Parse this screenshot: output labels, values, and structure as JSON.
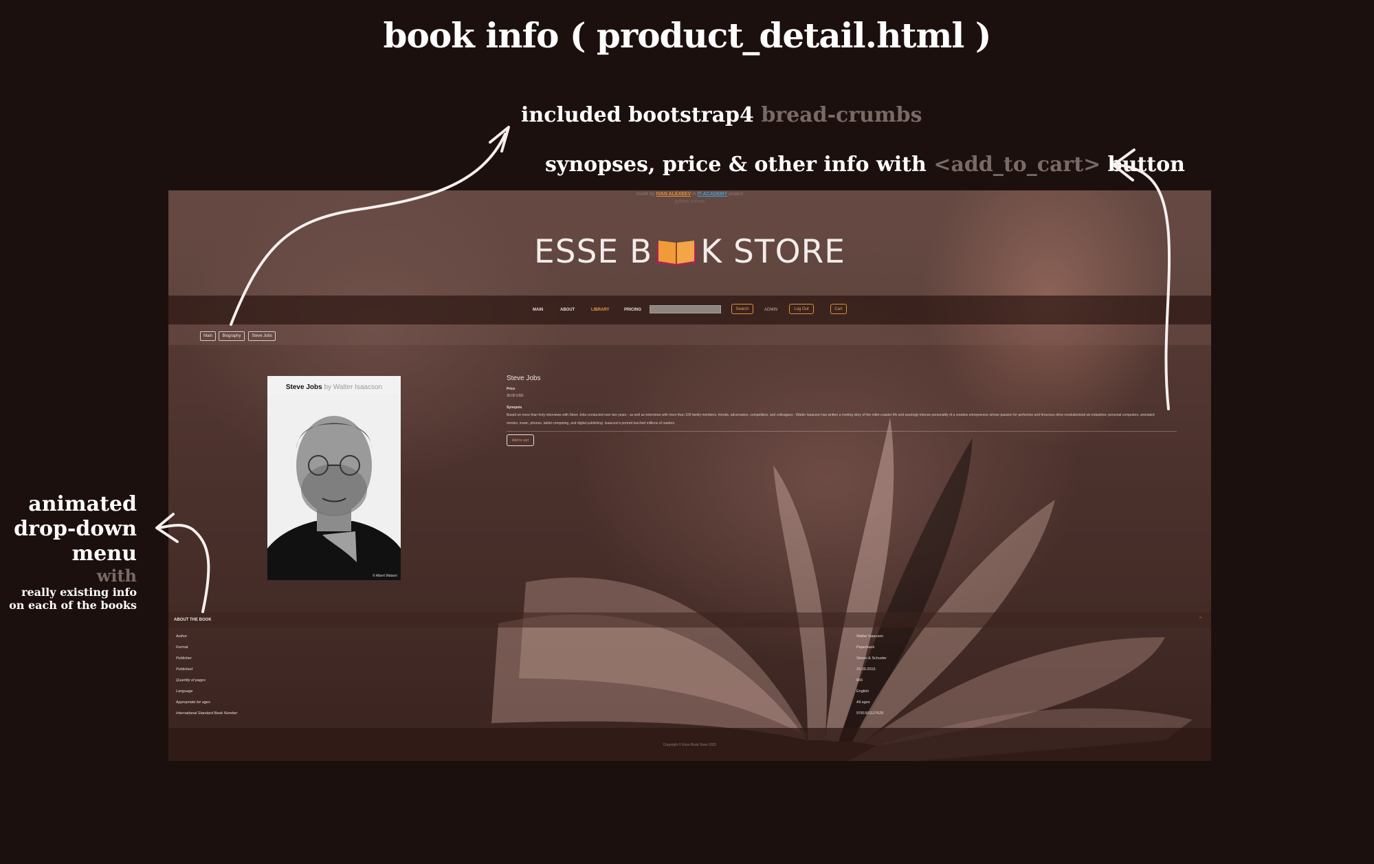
{
  "title": "book info ( product_detail.html )",
  "annotations": {
    "breadcrumbs_prefix": "included bootstrap4 ",
    "breadcrumbs_highlight": "bread-crumbs",
    "synopses_prefix": "synopses, price & other info with ",
    "synopses_highlight": "<add_to_cart>",
    "synopses_suffix": " button",
    "dropdown_line1": "animated",
    "dropdown_line2": "drop-down",
    "dropdown_line3": "menu",
    "dropdown_with": "with",
    "dropdown_small1": "really existing info",
    "dropdown_small2": "on each of the books"
  },
  "site": {
    "topline_prefix": "made by",
    "topline_name": "IVAN ALEXEEV",
    "topline_mid": "in",
    "topline_org": "IT-ACADEMY",
    "topline_suffix": "project",
    "topline_line2": "python course",
    "logo_left": "ESSE B",
    "logo_right": "K STORE",
    "nav": {
      "main": "MAIN",
      "about": "ABOUT",
      "library": "LIBRARY",
      "pricing": "PRICING",
      "search_placeholder": "",
      "search_button": "Search",
      "admin": "ADMIN",
      "logout": "Log Out",
      "cart": "Cart"
    },
    "breadcrumbs": [
      "Main",
      "Biography",
      "Steve Jobs"
    ],
    "cover": {
      "title": "Steve Jobs",
      "by": " by Walter Isaacson",
      "credit": "© Albert Watson"
    },
    "book": {
      "title": "Steve Jobs",
      "price_label": "Price",
      "price_value": "30.00 USD",
      "synopsis_label": "Synopsis",
      "synopsis_text": "Based on more than forty interviews with Steve Jobs conducted over two years - as well as interviews with more than 100 family members, friends, adversaries, competitors, and colleagues - Walter Isaacson has written a riveting story of the roller-coaster life and searingly intense personality of a creative entrepreneur whose passion for perfection and ferocious drive revolutionized six industries: personal computers, animated movies, music, phones, tablet computing, and digital publishing. Isaacson's portrait touched millions of readers.",
      "add_to_cart": "Add to cart"
    },
    "about": {
      "title": "ABOUT THE BOOK",
      "rows": [
        {
          "k": "Author",
          "v": "Walter Isaacson"
        },
        {
          "k": "Format",
          "v": "Paperback"
        },
        {
          "k": "Publisher",
          "v": "Simon & Schuster"
        },
        {
          "k": "Published",
          "v": "15.09.2015"
        },
        {
          "k": "Quantity of pages",
          "v": "656"
        },
        {
          "k": "Language",
          "v": "English"
        },
        {
          "k": "Appropriate for ages",
          "v": "All ages"
        },
        {
          "k": "International Standard Book Number",
          "v": "9781501127625"
        }
      ]
    },
    "copyright": "Copyright © Esse Book Store 2021"
  },
  "colors": {
    "background": "#1c100e",
    "accent_orange": "#e3903a",
    "link_blue": "#4a9ed8",
    "muted_text": "#7a6a66"
  },
  "icons": [
    "open-book-icon",
    "chevron-up-icon",
    "curved-arrow-icon"
  ]
}
